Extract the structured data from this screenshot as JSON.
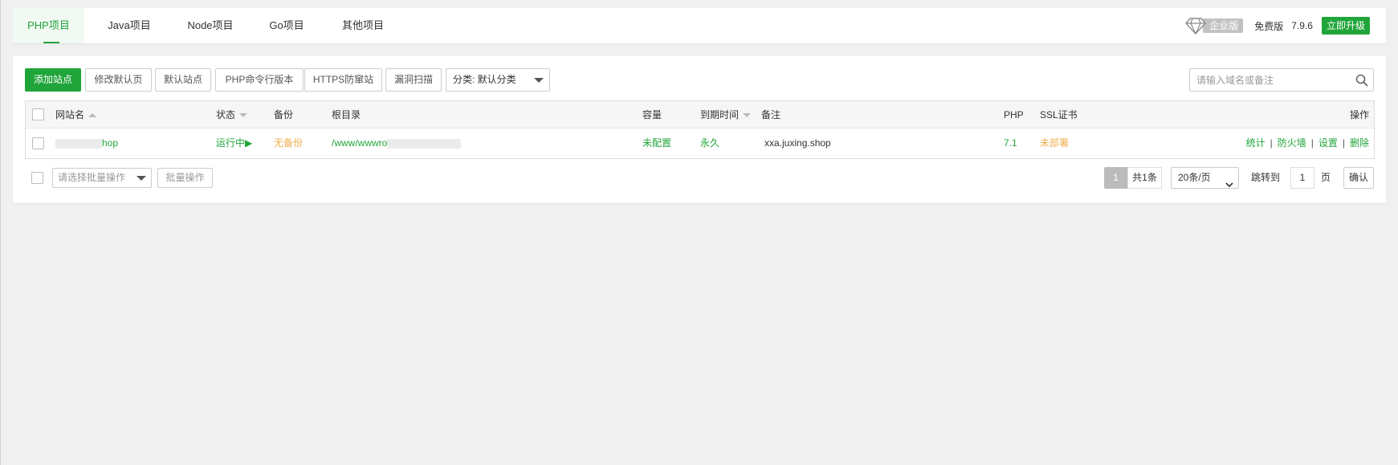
{
  "tabs": [
    {
      "label": "PHP项目",
      "active": true
    },
    {
      "label": "Java项目",
      "active": false
    },
    {
      "label": "Node项目",
      "active": false
    },
    {
      "label": "Go项目",
      "active": false
    },
    {
      "label": "其他项目",
      "active": false
    }
  ],
  "header_right": {
    "enterprise_icon": "diamond-icon",
    "enterprise_label": "企业版",
    "free_label": "免费版",
    "version": "7.9.6",
    "upgrade_label": "立即升级"
  },
  "toolbar": {
    "add_site": "添加站点",
    "edit_default_page": "修改默认页",
    "default_site": "默认站点",
    "php_cli_version": "PHP命令行版本",
    "https_anti_snoop": "HTTPS防窜站",
    "vuln_scan": "漏洞扫描",
    "category_select": "分类: 默认分类",
    "search_placeholder": "请输入域名或备注",
    "search_icon": "search-icon"
  },
  "table": {
    "headers": {
      "site_name": "网站名",
      "status": "状态",
      "backup": "备份",
      "root_dir": "根目录",
      "capacity": "容量",
      "expiry": "到期时间",
      "note": "备注",
      "php": "PHP",
      "ssl": "SSL证书",
      "actions": "操作"
    },
    "rows": [
      {
        "site_name_suffix": "hop",
        "status": "运行中▶",
        "backup": "无备份",
        "root_dir_prefix": "/www/wwwro",
        "capacity": "未配置",
        "expiry": "永久",
        "note": "xxa.juxing.shop",
        "php": "7.1",
        "ssl": "未部署",
        "actions": [
          "统计",
          "防火墙",
          "设置",
          "删除"
        ]
      }
    ]
  },
  "footer": {
    "batch_select_placeholder": "请选择批量操作",
    "batch_button": "批量操作",
    "current_page": "1",
    "total": "共1条",
    "page_size": "20条/页",
    "jump_label": "跳转到",
    "jump_value": "1",
    "page_unit": "页",
    "confirm": "确认"
  },
  "colors": {
    "accent": "#20a53a",
    "warning": "#f0ad4e",
    "badge_gray": "#c2c2c2"
  }
}
